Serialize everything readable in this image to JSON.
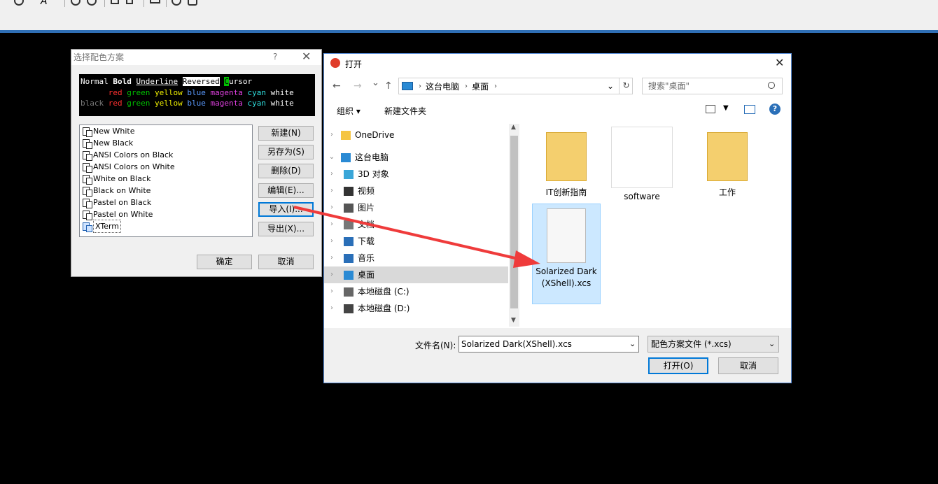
{
  "toolbar": {
    "icons": [
      "globe-icon",
      "font-icon",
      "moon-icon",
      "swap-icon",
      "fullscreen-icon",
      "lock-icon",
      "keyboard-icon",
      "help-icon",
      "chat-icon"
    ]
  },
  "scheme_dialog": {
    "title": "选择配色方案",
    "help": "?",
    "close": "✕",
    "preview": {
      "line1": {
        "normal": "Normal",
        "bold": "Bold",
        "underline": "Underline",
        "reversed": "Reversed",
        "cursor_c": "C",
        "cursor_rest": "ursor"
      },
      "line2": [
        "red",
        "green",
        "yellow",
        "blue",
        "magenta",
        "cyan",
        "white"
      ],
      "line3": [
        "black",
        "red",
        "green",
        "yellow",
        "blue",
        "magenta",
        "cyan",
        "white"
      ],
      "colors": {
        "red": "#ff3030",
        "green": "#00c000",
        "yellow": "#f0f000",
        "blue": "#5b9bff",
        "magenta": "#e040e0",
        "cyan": "#30e0e0",
        "white": "#ffffff",
        "black": "#7a7a7a"
      }
    },
    "schemes": [
      "New White",
      "New Black",
      "ANSI Colors on Black",
      "ANSI Colors on White",
      "White on Black",
      "Black on White",
      "Pastel on Black",
      "Pastel on White",
      "XTerm"
    ],
    "selected": "XTerm",
    "buttons": {
      "new": "新建(N)",
      "save_as": "另存为(S)",
      "delete": "删除(D)",
      "edit": "编辑(E)...",
      "import": "导入(I)...",
      "export": "导出(X)...",
      "ok": "确定",
      "cancel": "取消"
    }
  },
  "open_dialog": {
    "title": "打开",
    "close": "✕",
    "nav": {
      "back": "←",
      "forward": "→",
      "dropdown": "⌄",
      "up": "↑"
    },
    "breadcrumb": [
      "这台电脑",
      "桌面"
    ],
    "refresh": "↻",
    "search_placeholder": "搜索\"桌面\"",
    "commands": {
      "organize": "组织 ▾",
      "new_folder": "新建文件夹",
      "help": "?"
    },
    "nav_items": [
      {
        "label": "OneDrive",
        "indent": 0
      },
      {
        "label": "这台电脑",
        "indent": 0
      },
      {
        "label": "3D 对象",
        "indent": 1
      },
      {
        "label": "视频",
        "indent": 1
      },
      {
        "label": "图片",
        "indent": 1
      },
      {
        "label": "文档",
        "indent": 1
      },
      {
        "label": "下载",
        "indent": 1
      },
      {
        "label": "音乐",
        "indent": 1
      },
      {
        "label": "桌面",
        "indent": 1
      },
      {
        "label": "本地磁盘 (C:)",
        "indent": 1
      },
      {
        "label": "本地磁盘 (D:)",
        "indent": 1
      }
    ],
    "nav_selected": "桌面",
    "files": [
      {
        "name": "IT创新指南",
        "type": "folder"
      },
      {
        "name": "software",
        "type": "shortcut"
      },
      {
        "name": "工作",
        "type": "folder"
      },
      {
        "name": "Solarized Dark(XShell).xcs",
        "type": "file"
      }
    ],
    "file_selected": "Solarized Dark(XShell).xcs",
    "filename_label": "文件名(N):",
    "filename_value": "Solarized Dark(XShell).xcs",
    "filetype_value": "配色方案文件 (*.xcs)",
    "open_button": "打开(O)",
    "cancel_button": "取消"
  },
  "annotation": {
    "arrow_color": "#ef3b3b"
  }
}
